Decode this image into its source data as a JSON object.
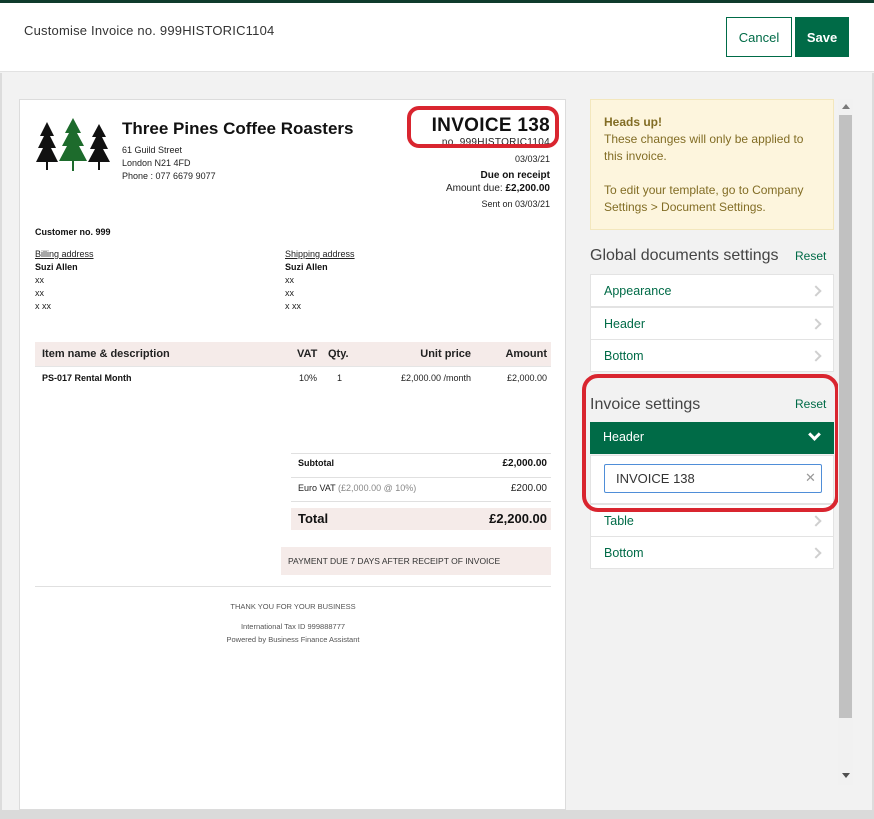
{
  "modal": {
    "title": "Customise Invoice no. 999HISTORIC1104",
    "cancel_label": "Cancel",
    "save_label": "Save"
  },
  "invoice": {
    "company_name": "Three Pines Coffee Roasters",
    "address_lines": [
      "61 Guild Street",
      "London N21 4FD",
      "Phone : 077 6679 9077"
    ],
    "title": "INVOICE 138",
    "number": "no. 999HISTORIC1104",
    "date": "03/03/21",
    "due": "Due on receipt",
    "amount_due_label": "Amount due:",
    "amount_due": "£2,200.00",
    "sent": "Sent on 03/03/21",
    "customer_no": "Customer no. 999",
    "billing": {
      "label": "Billing address",
      "name": "Suzi Allen",
      "lines": [
        "xx",
        "xx",
        "x xx"
      ]
    },
    "shipping": {
      "label": "Shipping address",
      "name": "Suzi Allen",
      "lines": [
        "xx",
        "xx",
        "x xx"
      ]
    },
    "table": {
      "headers": {
        "item": "Item name & description",
        "vat": "VAT",
        "qty": "Qty.",
        "unit_price": "Unit price",
        "amount": "Amount"
      },
      "rows": [
        {
          "item": "PS-017 Rental Month",
          "vat": "10%",
          "qty": "1",
          "unit_price": "£2,000.00 /month",
          "amount": "£2,000.00"
        }
      ]
    },
    "subtotal_label": "Subtotal",
    "subtotal": "£2,000.00",
    "vat_label": "Euro VAT",
    "vat_detail": "(£2,000.00 @ 10%)",
    "vat_amount": "£200.00",
    "total_label": "Total",
    "total": "£2,200.00",
    "payment_note": "PAYMENT DUE 7 DAYS AFTER RECEIPT OF INVOICE",
    "footer_thanks": "THANK YOU FOR YOUR BUSINESS",
    "footer_tax": "International Tax ID 999888777",
    "footer_powered": "Powered by Business Finance Assistant"
  },
  "sidebar": {
    "notice": {
      "title": "Heads up!",
      "line1": "These changes will only be applied to this invoice.",
      "line2": "To edit your template, go to Company Settings > Document Settings."
    },
    "global": {
      "title": "Global documents settings",
      "reset_label": "Reset",
      "items": [
        "Appearance",
        "Header",
        "Bottom"
      ]
    },
    "invoice_settings": {
      "title": "Invoice settings",
      "reset_label": "Reset",
      "active_item": "Header",
      "header_input_value": "INVOICE 138",
      "items": [
        "Table",
        "Bottom"
      ]
    }
  },
  "colors": {
    "brand_green": "#006b47",
    "highlight_red": "#d9252f",
    "notice_bg": "#fdf5dd",
    "table_header_bg": "#f5ebe9"
  }
}
